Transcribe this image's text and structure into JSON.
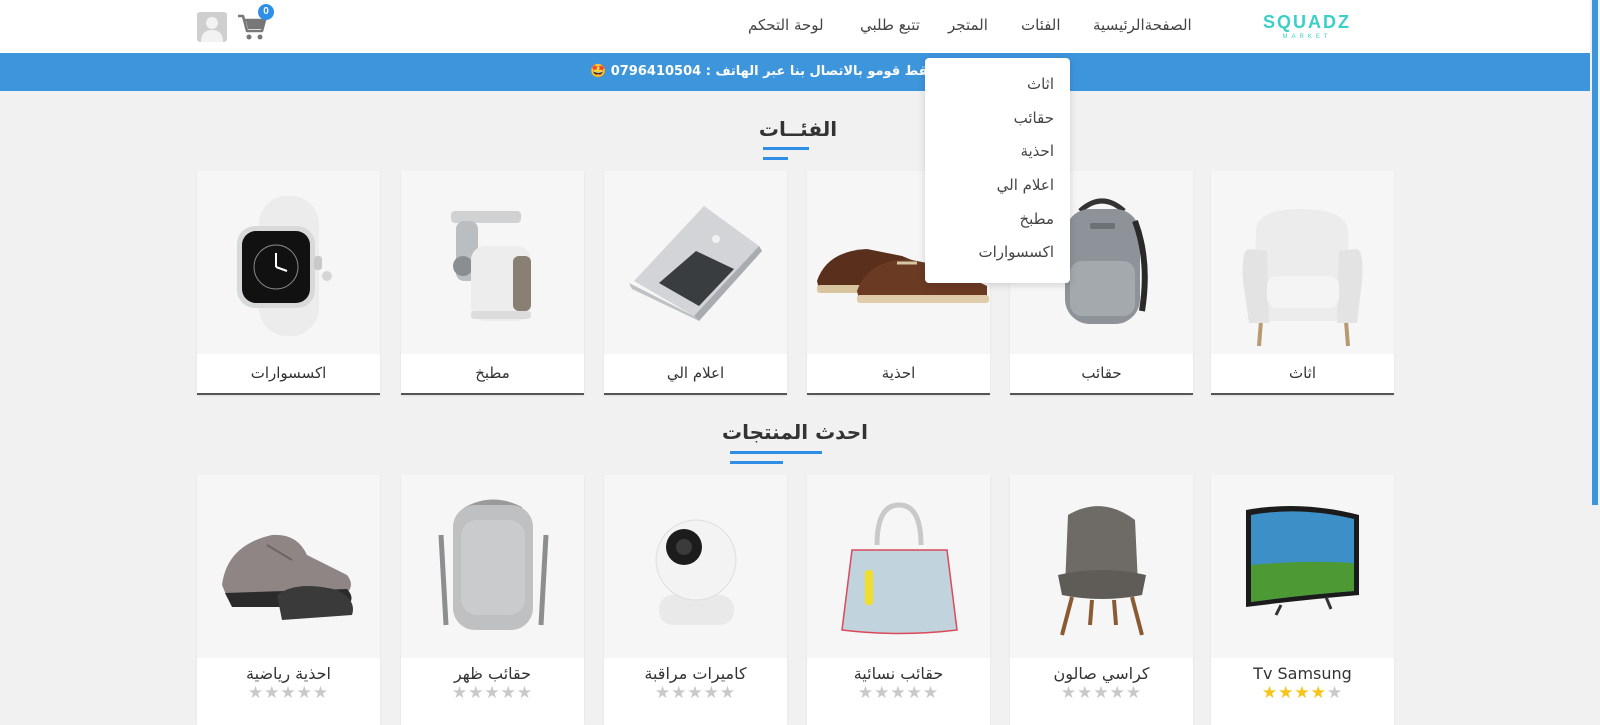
{
  "header": {
    "logo_text": "SQUADZ",
    "logo_subtext": "MARKET",
    "nav": [
      "الصفحةالرئيسية",
      "الفئات",
      "المتجر",
      "تتبع طلبي",
      "لوحة التحكم"
    ],
    "cart_count": "0"
  },
  "announcement": {
    "text": "ر الكتروني فقط قومو بالاتصال بنا عبر الهاتف : 0796410504 🤩"
  },
  "dropdown": {
    "items": [
      "اثاث",
      "حقائب",
      "احذية",
      "اعلام الي",
      "مطبخ",
      "اكسسوارات"
    ]
  },
  "categories": {
    "title": "الفئــات",
    "items": [
      "اثاث",
      "حقائب",
      "احذية",
      "اعلام الي",
      "مطبخ",
      "اكسسوارات"
    ]
  },
  "products": {
    "title": "احدث المنتجات",
    "items": [
      {
        "name": "Tv Samsung",
        "rating": 4
      },
      {
        "name": "كراسي صالون",
        "rating": 0
      },
      {
        "name": "حقائب نسائية",
        "rating": 0
      },
      {
        "name": "كاميرات مراقبة",
        "rating": 0
      },
      {
        "name": "حقائب ظهر",
        "rating": 0
      },
      {
        "name": "احذية رياضية",
        "rating": 0
      }
    ]
  },
  "colors": {
    "accent": "#3d95dc",
    "star_on": "#f5c518",
    "star_off": "#c9c9c9"
  }
}
